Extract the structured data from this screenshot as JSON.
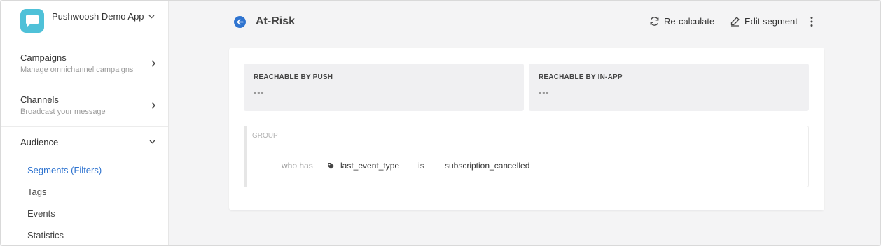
{
  "app": {
    "name": "Pushwoosh Demo App",
    "logo_color": "#4fc1d8"
  },
  "sidebar": {
    "sections": [
      {
        "title": "Campaigns",
        "subtitle": "Manage omnichannel campaigns"
      },
      {
        "title": "Channels",
        "subtitle": "Broadcast your message"
      }
    ],
    "audience": {
      "title": "Audience",
      "items": [
        {
          "label": "Segments (Filters)",
          "active": true
        },
        {
          "label": "Tags"
        },
        {
          "label": "Events"
        },
        {
          "label": "Statistics"
        }
      ]
    }
  },
  "header": {
    "title": "At-Risk",
    "recalculate_label": "Re-calculate",
    "edit_label": "Edit segment"
  },
  "stats": [
    {
      "label": "REACHABLE BY PUSH",
      "value": "•••"
    },
    {
      "label": "REACHABLE BY IN-APP",
      "value": "•••"
    }
  ],
  "group": {
    "label": "GROUP",
    "rule": {
      "prefix": "who has",
      "attribute": "last_event_type",
      "operator": "is",
      "value": "subscription_cancelled"
    }
  },
  "colors": {
    "accent": "#2f74d0",
    "sidebar_bg": "#ffffff",
    "page_bg": "#f4f4f5"
  },
  "icons": [
    "chevron-down-icon",
    "chevron-right-icon",
    "back-arrow-icon",
    "refresh-icon",
    "pencil-icon",
    "more-vertical-icon",
    "tag-icon",
    "chat-bubble-icon"
  ]
}
